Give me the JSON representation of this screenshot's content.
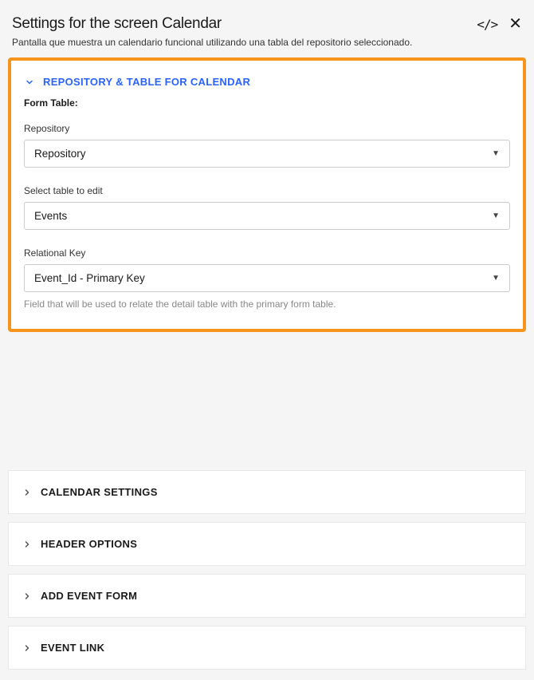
{
  "header": {
    "title": "Settings for the screen Calendar",
    "subtitle": "Pantalla que muestra un calendario funcional utilizando una tabla del repositorio seleccionado."
  },
  "sections": {
    "repoTable": {
      "title": "REPOSITORY & TABLE FOR CALENDAR",
      "formTableLabel": "Form Table:",
      "fields": {
        "repository": {
          "label": "Repository",
          "value": "Repository"
        },
        "table": {
          "label": "Select table to edit",
          "value": "Events"
        },
        "relationalKey": {
          "label": "Relational Key",
          "value": "Event_Id - Primary Key",
          "helper": "Field that will be used to relate the detail table with the primary form table."
        }
      }
    },
    "collapsed": [
      {
        "title": "CALENDAR SETTINGS"
      },
      {
        "title": "HEADER OPTIONS"
      },
      {
        "title": "ADD EVENT FORM"
      },
      {
        "title": "EVENT LINK"
      }
    ]
  }
}
